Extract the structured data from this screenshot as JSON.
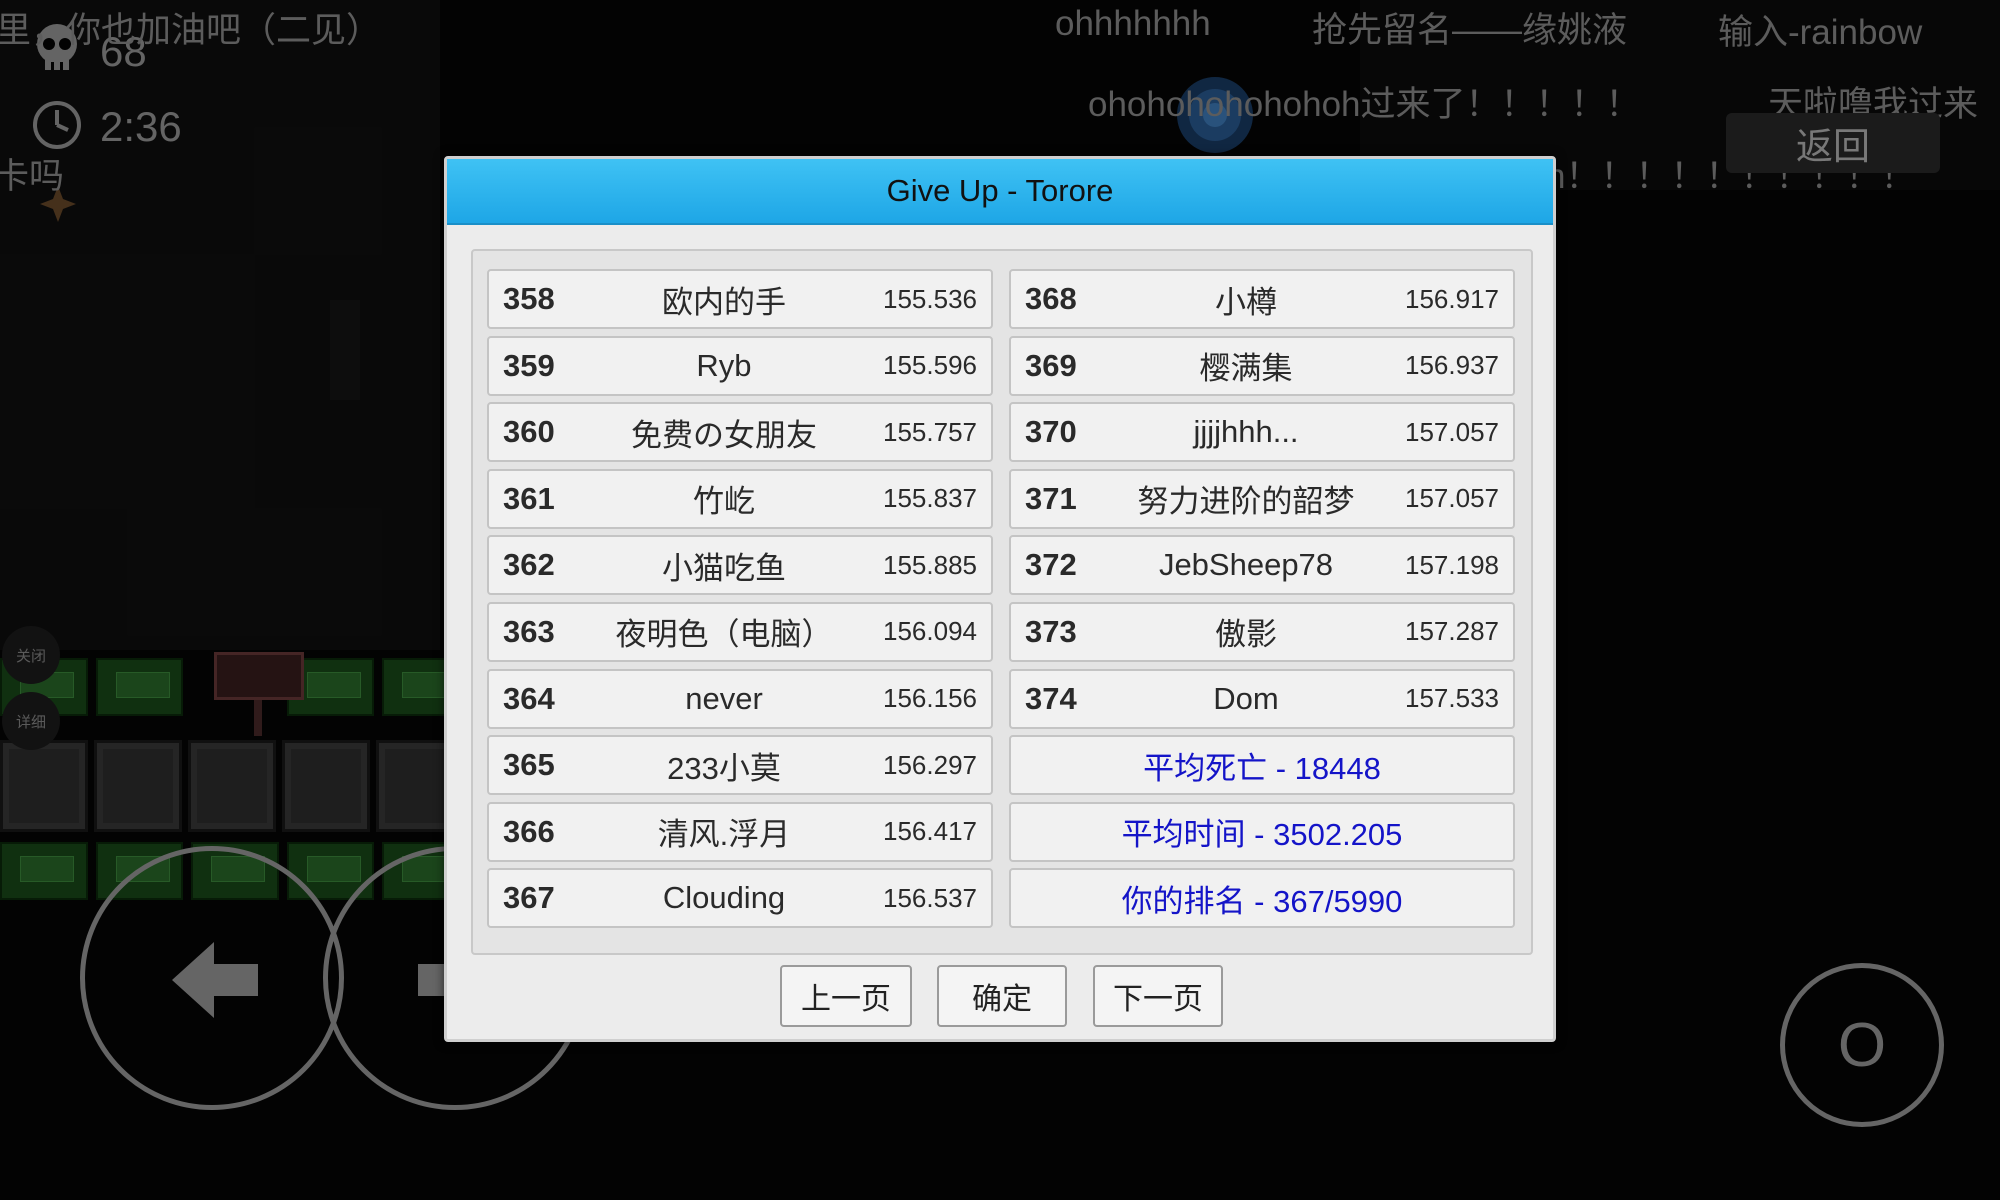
{
  "hud": {
    "deaths": "68",
    "timer": "2:36"
  },
  "danmaku": [
    "里，你也加油吧（二见）",
    "ohhhhhhh",
    "抢先留名——缘姚液",
    "输入-rainbow",
    "ohohohohohohoh过来了！！！！！",
    "天啦噜我过来",
    "h！！！！！！！！！！",
    "卡吗"
  ],
  "side_buttons": {
    "close": "关闭",
    "detail": "详细"
  },
  "back_button": "返回",
  "controls": {
    "jump": "O"
  },
  "dialog": {
    "title": "Give Up - Torore",
    "left_ranks": [
      {
        "rank": "358",
        "name": "欧内的手",
        "time": "155.536"
      },
      {
        "rank": "359",
        "name": "Ryb",
        "time": "155.596"
      },
      {
        "rank": "360",
        "name": "免费の女朋友",
        "time": "155.757"
      },
      {
        "rank": "361",
        "name": "竹屹",
        "time": "155.837"
      },
      {
        "rank": "362",
        "name": "小猫吃鱼",
        "time": "155.885"
      },
      {
        "rank": "363",
        "name": "夜明色（电脑）",
        "time": "156.094"
      },
      {
        "rank": "364",
        "name": "never",
        "time": "156.156"
      },
      {
        "rank": "365",
        "name": "233小莫",
        "time": "156.297"
      },
      {
        "rank": "366",
        "name": "清风.浮月",
        "time": "156.417"
      },
      {
        "rank": "367",
        "name": "Clouding",
        "time": "156.537"
      }
    ],
    "right_ranks": [
      {
        "rank": "368",
        "name": "小樽",
        "time": "156.917"
      },
      {
        "rank": "369",
        "name": "樱满集",
        "time": "156.937"
      },
      {
        "rank": "370",
        "name": "jjjjhhh...",
        "time": "157.057"
      },
      {
        "rank": "371",
        "name": "努力进阶的韶梦",
        "time": "157.057"
      },
      {
        "rank": "372",
        "name": "JebSheep78",
        "time": "157.198"
      },
      {
        "rank": "373",
        "name": "傲影",
        "time": "157.287"
      },
      {
        "rank": "374",
        "name": "Dom",
        "time": "157.533"
      }
    ],
    "stats": {
      "avg_deaths": "平均死亡 - 18448",
      "avg_time": "平均时间 - 3502.205",
      "my_rank": "你的排名 - 367/5990"
    },
    "buttons": {
      "prev": "上一页",
      "confirm": "确定",
      "next": "下一页"
    }
  },
  "colors": {
    "header": "#1ea6e6",
    "stat_text": "#1414c8"
  }
}
